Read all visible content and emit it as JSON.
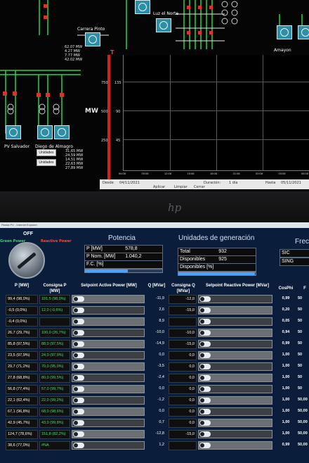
{
  "scada": {
    "stations": [
      "PV Salvador",
      "Diego de Almagro",
      "Luz el Norte",
      "Carrera Pinto",
      "Amayon"
    ],
    "bus_readings_1": [
      "62.07 MW",
      "4.27 MW",
      "7.77 MW",
      "42.02 MW"
    ],
    "bus_readings_2": [
      "31,65 MW",
      "24,59 MW",
      "14,51 MW",
      "22,63 MW",
      "27,89 MW"
    ],
    "buttons": [
      "Unidades",
      "Unidades"
    ],
    "chart": {
      "ylabel": "MW",
      "y_ticks_left": [
        "750",
        "500",
        "250"
      ],
      "y_ticks_right": [
        "135",
        "90",
        "45"
      ],
      "marker": "T",
      "x_labels": [
        "06:08",
        "09:08",
        "12:08",
        "15:08",
        "18:08",
        "21:08",
        "00:08",
        "03:08",
        "06:08"
      ]
    },
    "bottombar": {
      "labels": [
        "Desde",
        "Duración:",
        "Hasta"
      ],
      "date_from": "04/11/2021",
      "duration": "1 día",
      "date_to": "05/11/2021",
      "buttons": [
        "Aplicar",
        "Limpiar",
        "Cerrar"
      ]
    },
    "brand": "hp"
  },
  "panel": {
    "window_title": "Planta PV - Internet Explorer",
    "off_label": "OFF",
    "green_label": "Green Power",
    "red_label": "Reactive Power",
    "potencia": {
      "title": "Potencia",
      "p_mw_label": "P [MW]",
      "p_mw_value": "578,8",
      "p_nom_label": "P Nom. [MW]",
      "p_nom_value": "1.040,2",
      "fc_label": "F.C. [%]",
      "fc_fraction": 0.556
    },
    "unidades": {
      "title": "Unidades de generación",
      "total_label": "Total",
      "total_value": "932",
      "disp_label": "Disponibles",
      "disp_value": "925",
      "disp_pct_label": "Disponibles [%]",
      "disp_fraction": 0.992
    },
    "freq": {
      "title": "Frec",
      "labels": [
        "SIC",
        "SING"
      ]
    }
  },
  "table": {
    "headers": [
      "P [MW]",
      "Consigna P [MW]",
      "Setpoint Active Power [MW]",
      "Q [MVar]",
      "Consigna Q [MVar]",
      "Setpoint Reactive Power [MVar]",
      "CosPhi",
      "F"
    ],
    "rows": [
      {
        "p": "99,4 (98,0%)",
        "cp": "101,5 (98,0%)",
        "q": "-11,9",
        "cq": "-12,0",
        "cos": "0,99",
        "f": "50"
      },
      {
        "p": "-0,5 (0,0%)",
        "cp": "12,0 (-0,6%)",
        "q": "2,6",
        "cq": "-15,0",
        "cos": "0,20",
        "f": "50"
      },
      {
        "p": "-0,4 (0,0%)",
        "cp": "",
        "q": "8,9",
        "cq": "",
        "cos": "0,05",
        "f": "50"
      },
      {
        "p": "26,7 (29,7%)",
        "cp": "100,0 (26,7%)",
        "q": "-10,0",
        "cq": "-10,0",
        "cos": "0,94",
        "f": "50"
      },
      {
        "p": "85,8 (97,5%)",
        "cp": "88,0 (97,5%)",
        "q": "-14,9",
        "cq": "-15,0",
        "cos": "0,99",
        "f": "50"
      },
      {
        "p": "23,5 (97,9%)",
        "cp": "24,0 (97,9%)",
        "q": "0,0",
        "cq": "0,0",
        "cos": "1,00",
        "f": "50"
      },
      {
        "p": "29,7 (71,2%)",
        "cp": "70,0 (95,0%)",
        "q": "-3,5",
        "cq": "0,0",
        "cos": "1,00",
        "f": "50"
      },
      {
        "p": "27,8 (68,8%)",
        "cp": "80,0 (99,5%)",
        "q": "-2,4",
        "cq": "0,0",
        "cos": "1,00",
        "f": "50"
      },
      {
        "p": "56,8 (77,4%)",
        "cp": "57,0 (99,7%)",
        "q": "0,0",
        "cq": "0,0",
        "cos": "1,00",
        "f": "50"
      },
      {
        "p": "22,1 (62,4%)",
        "cp": "22,0 (99,2%)",
        "q": "-1,2",
        "cq": "0,0",
        "cos": "1,00",
        "f": "50,00"
      },
      {
        "p": "67,1 (96,8%)",
        "cp": "68,0 (98,6%)",
        "q": "0,0",
        "cq": "0,0",
        "cos": "1,00",
        "f": "50,00"
      },
      {
        "p": "42,9 (45,7%)",
        "cp": "43,0 (99,8%)",
        "q": "0,7",
        "cq": "0,0",
        "cos": "1,00",
        "f": "50,00"
      },
      {
        "p": "124,7 (78,6%)",
        "cp": "151,8 (82,2%)",
        "q": "-12,8",
        "cq": "-15,0",
        "cos": "1,00",
        "f": "50,00"
      },
      {
        "p": "38,6 (77,0%)",
        "cp": "#NA",
        "q": "1,2",
        "cq": "",
        "cos": "0,99",
        "f": "50,00"
      }
    ]
  }
}
